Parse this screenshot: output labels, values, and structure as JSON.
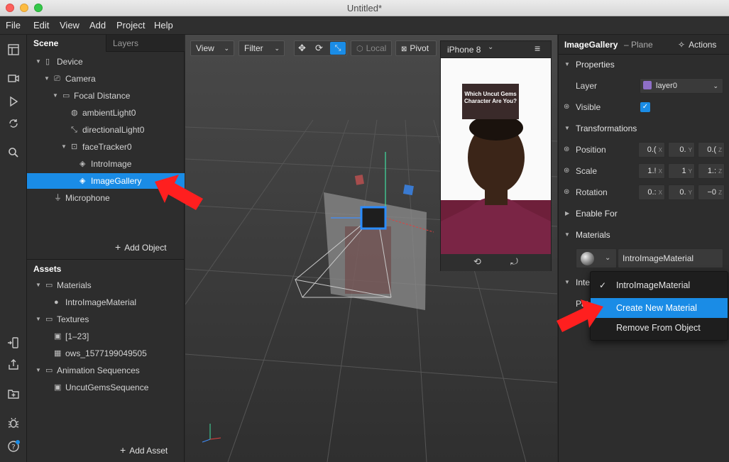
{
  "window": {
    "title": "Untitled*"
  },
  "menu": [
    "File",
    "Edit",
    "View",
    "Add",
    "Project",
    "Help"
  ],
  "scene": {
    "tabs": [
      "Scene",
      "Layers"
    ],
    "items": [
      {
        "label": "Device",
        "depth": 0,
        "arrow": true,
        "icon": "device-icon"
      },
      {
        "label": "Camera",
        "depth": 1,
        "arrow": true,
        "icon": "camera-icon"
      },
      {
        "label": "Focal Distance",
        "depth": 2,
        "arrow": true,
        "icon": "focal-icon"
      },
      {
        "label": "ambientLight0",
        "depth": 3,
        "arrow": false,
        "icon": "ambient-light-icon"
      },
      {
        "label": "directionalLight0",
        "depth": 3,
        "arrow": false,
        "icon": "directional-light-icon"
      },
      {
        "label": "faceTracker0",
        "depth": 3,
        "arrow": true,
        "icon": "face-tracker-icon"
      },
      {
        "label": "IntroImage",
        "depth": 4,
        "arrow": false,
        "icon": "plane-icon"
      },
      {
        "label": "ImageGallery",
        "depth": 4,
        "arrow": false,
        "icon": "plane-icon",
        "selected": true
      },
      {
        "label": "Microphone",
        "depth": 1,
        "arrow": false,
        "icon": "microphone-icon"
      }
    ],
    "add_label": "Add Object"
  },
  "assets": {
    "title": "Assets",
    "items": [
      {
        "label": "Materials",
        "depth": 0,
        "arrow": true,
        "icon": "folder-icon"
      },
      {
        "label": "IntroImageMaterial",
        "depth": 1,
        "arrow": false,
        "icon": "material-sphere-icon"
      },
      {
        "label": "Textures",
        "depth": 0,
        "arrow": true,
        "icon": "folder-icon"
      },
      {
        "label": "[1–23]",
        "depth": 1,
        "arrow": false,
        "icon": "texture-icon"
      },
      {
        "label": "ows_1577199049505",
        "depth": 1,
        "arrow": false,
        "icon": "texture-thumb-icon"
      },
      {
        "label": "Animation Sequences",
        "depth": 0,
        "arrow": true,
        "icon": "folder-icon"
      },
      {
        "label": "UncutGemsSequence",
        "depth": 1,
        "arrow": false,
        "icon": "sequence-icon"
      }
    ],
    "add_label": "Add Asset"
  },
  "viewport": {
    "view_label": "View",
    "filter_label": "Filter",
    "local_label": "Local",
    "pivot_label": "Pivot",
    "device_label": "iPhone 8",
    "phone_overlay_text": "Which Uncut Gems Character Are You?"
  },
  "inspector": {
    "object_name": "ImageGallery",
    "object_type": "– Plane",
    "actions_label": "Actions",
    "properties_label": "Properties",
    "layer_label": "Layer",
    "layer_value": "layer0",
    "visible_label": "Visible",
    "transformations_label": "Transformations",
    "position_label": "Position",
    "position_values": [
      "0.(",
      "0.",
      "0.("
    ],
    "scale_label": "Scale",
    "scale_values": [
      "1.!",
      "1",
      "1.:"
    ],
    "rotation_label": "Rotation",
    "rotation_values": [
      "0.:",
      "0.",
      "−0"
    ],
    "axis_labels": [
      "X",
      "Y",
      "Z"
    ],
    "enable_for_label": "Enable For",
    "materials_label": "Materials",
    "material_value": "IntroImageMaterial",
    "interactions_label": "Inte",
    "patch_label": "Patc"
  },
  "dropdown": {
    "items": [
      {
        "label": "IntroImageMaterial",
        "checked": true
      },
      {
        "label": "Create New Material",
        "highlighted": true
      },
      {
        "label": "Remove From Object"
      }
    ]
  },
  "colors": {
    "accent": "#1a8ce6",
    "layer_swatch": "#8e6fc7",
    "arrow": "#ff1f1f"
  }
}
